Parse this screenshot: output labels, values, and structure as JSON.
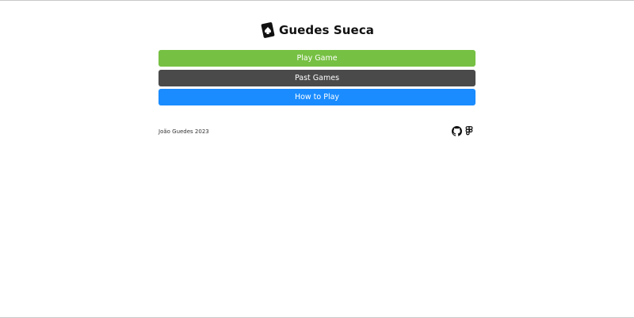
{
  "header": {
    "logo_icon": "spade-card-icon",
    "title": "Guedes Sueca"
  },
  "menu": {
    "play_label": "Play Game",
    "past_label": "Past Games",
    "how_label": "How to Play"
  },
  "footer": {
    "credit": "João Guedes 2023",
    "icons": [
      "github-icon",
      "figma-icon"
    ]
  },
  "colors": {
    "play": "#76c043",
    "past": "#4a4a4a",
    "how": "#1a8cff"
  }
}
